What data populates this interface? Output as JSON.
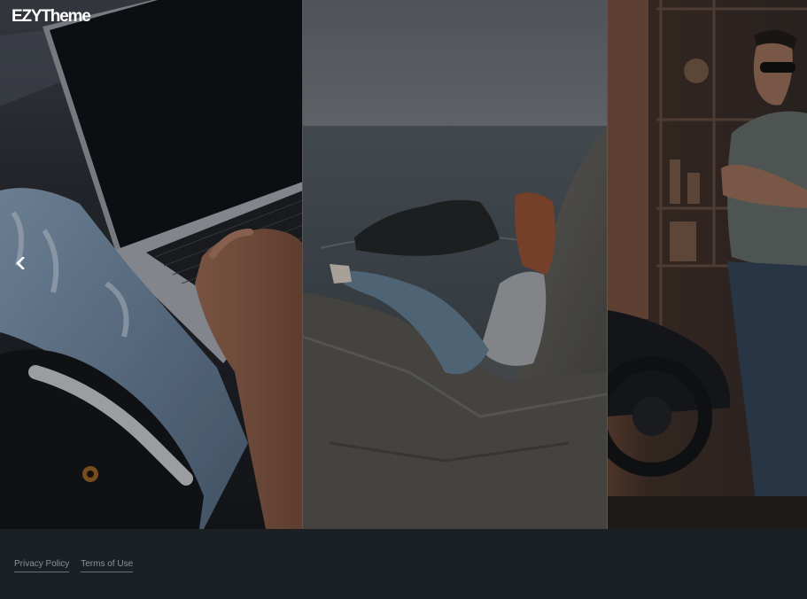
{
  "header": {
    "logo_text": "EZYTheme"
  },
  "slider": {
    "prev_icon": "chevron-left-icon",
    "panels": [
      {
        "subject": "laptop-dog-photo"
      },
      {
        "subject": "coast-woman-photo"
      },
      {
        "subject": "motorcycle-man-photo"
      }
    ]
  },
  "footer": {
    "links": [
      "Privacy Policy",
      "Terms of Use"
    ]
  },
  "colors": {
    "footer_bg": "#1b2025",
    "link_text": "#8a9197",
    "logo": "#ffffff"
  }
}
